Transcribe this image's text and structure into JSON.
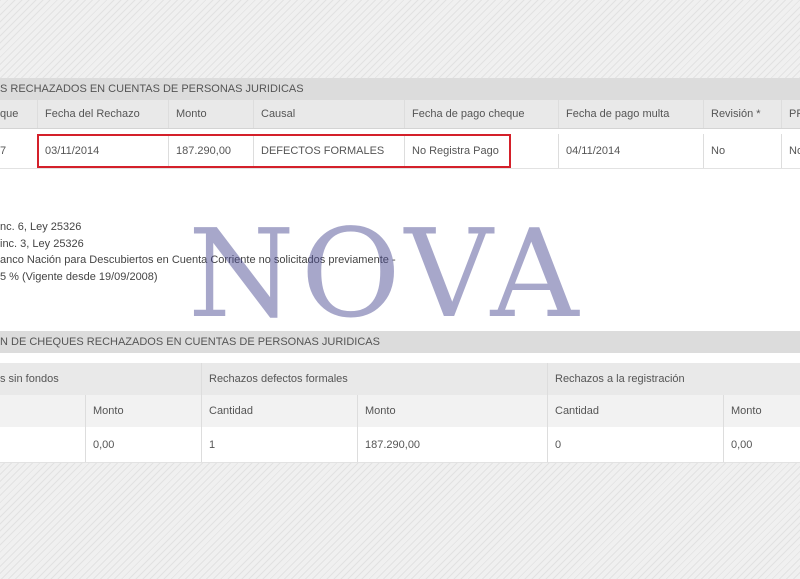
{
  "table1": {
    "title": "S RECHAZADOS EN CUENTAS DE PERSONAS JURIDICAS",
    "headers": [
      "que",
      "Fecha del Rechazo",
      "Monto",
      "Causal",
      "Fecha de pago cheque",
      "Fecha de pago multa",
      "Revisión *",
      "PR"
    ],
    "row": [
      "7",
      "03/11/2014",
      "187.290,00",
      "DEFECTOS FORMALES",
      "No Registra Pago",
      "04/11/2014",
      "No",
      "No"
    ]
  },
  "notes": [
    "nc. 6, Ley 25326",
    "inc. 3, Ley 25326",
    "anco Nación para Descubiertos en Cuenta Corriente no solicitados previamente -",
    "5 % (Vigente desde 19/09/2008)"
  ],
  "watermark": "NOVA",
  "table2": {
    "title": "N DE CHEQUES RECHAZADOS EN CUENTAS DE PERSONAS JURIDICAS",
    "groups": [
      "s sin fondos",
      "Rechazos defectos formales",
      "Rechazos a la registración"
    ],
    "subheaders": [
      "",
      "Monto",
      "Cantidad",
      "Monto",
      "Cantidad",
      "Monto"
    ],
    "row": [
      "",
      "0,00",
      "1",
      "187.290,00",
      "0",
      "0,00"
    ]
  },
  "colors": {
    "highlight": "#d4202a",
    "watermark": "#484891",
    "band": "#dcdcdc"
  }
}
